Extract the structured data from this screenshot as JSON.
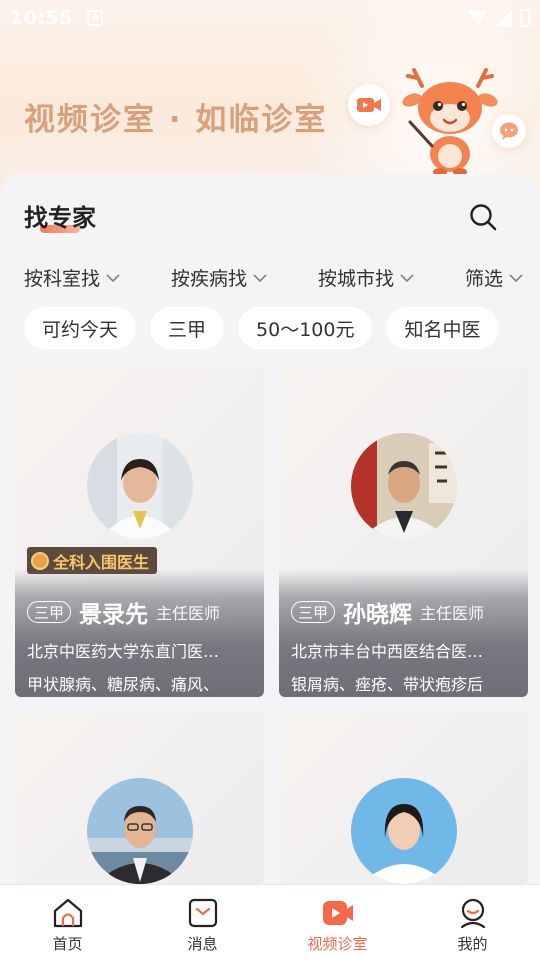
{
  "status_bar": {
    "time": "10:55"
  },
  "banner": {
    "title": "视频诊室 · 如临诊室"
  },
  "section": {
    "title": "找专家"
  },
  "filters": [
    {
      "label": "按科室找"
    },
    {
      "label": "按疾病找"
    },
    {
      "label": "按城市找"
    },
    {
      "label": "筛选"
    }
  ],
  "chips": [
    {
      "label": "可约今天"
    },
    {
      "label": "三甲"
    },
    {
      "label": "50～100元"
    },
    {
      "label": "知名中医"
    }
  ],
  "doctors": [
    {
      "award": "全科入围医生",
      "grade": "三甲",
      "name": "景录先",
      "title": "主任医师",
      "hospital": "北京中医药大学东直门医…",
      "specialty": "甲状腺病、糖尿病、痛风、"
    },
    {
      "grade": "三甲",
      "name": "孙晓辉",
      "title": "主任医师",
      "hospital": "北京市丰台中西医结合医…",
      "specialty": "银屑病、痤疮、带状疱疹后"
    },
    {},
    {}
  ],
  "nav": [
    {
      "label": "首页",
      "icon": "home-icon"
    },
    {
      "label": "消息",
      "icon": "message-icon"
    },
    {
      "label": "视频诊室",
      "icon": "video-clinic-icon",
      "active": true
    },
    {
      "label": "我的",
      "icon": "profile-icon"
    }
  ],
  "colors": {
    "accent": "#f26a4a",
    "banner_text": "#d9a07c",
    "award_text": "#f5c66a"
  }
}
